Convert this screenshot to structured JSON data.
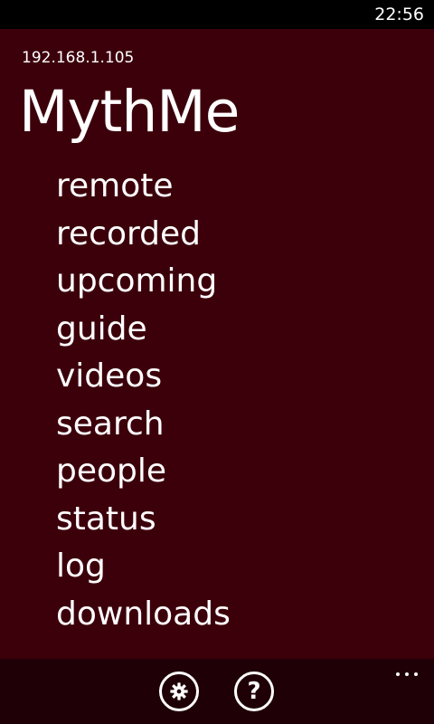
{
  "status_bar": {
    "time": "22:56"
  },
  "header": {
    "server_address": "192.168.1.105",
    "app_title": "MythMe"
  },
  "menu": {
    "items": [
      {
        "label": "remote"
      },
      {
        "label": "recorded"
      },
      {
        "label": "upcoming"
      },
      {
        "label": "guide"
      },
      {
        "label": "videos"
      },
      {
        "label": "search"
      },
      {
        "label": "people"
      },
      {
        "label": "status"
      },
      {
        "label": "log"
      },
      {
        "label": "downloads"
      }
    ]
  },
  "app_bar": {
    "buttons": [
      {
        "icon": "gear-icon"
      },
      {
        "icon": "question-icon",
        "glyph": "?"
      }
    ],
    "more_icon": "ellipsis-icon"
  },
  "colors": {
    "background": "#3c000b",
    "app_bar": "#1f0006",
    "status_bar": "#000000",
    "text": "#ffffff"
  }
}
